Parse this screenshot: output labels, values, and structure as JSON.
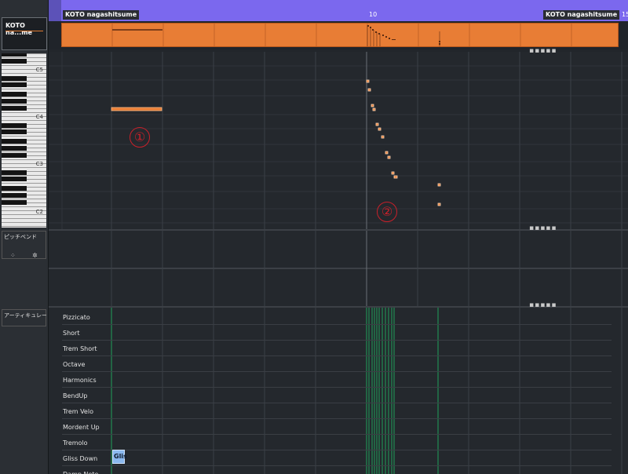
{
  "part": {
    "name_left": "KOTO nagashitsume",
    "name_right": "KOTO nagashitsume",
    "ruler_bar_10": "10",
    "ruler_bar_15": "15",
    "color": "#e87d35"
  },
  "track": {
    "label": "KOTO na...me"
  },
  "keyboard": {
    "labels": [
      "C5",
      "C4",
      "C3",
      "C2"
    ]
  },
  "controller_lanes": {
    "pitchbend_label": "ピッチベンド",
    "articulation_label": "アーティキュレーション"
  },
  "articulations": [
    "Pizzicato",
    "Short",
    "Trem Short",
    "Octave",
    "Harmonics",
    "BendUp",
    "Trem Velo",
    "Mordent Up",
    "Tremolo",
    "Gliss Down",
    "Damp Note"
  ],
  "gliss_block_label": "Glis",
  "annotations": {
    "one": "①",
    "two": "②"
  },
  "icons": {
    "pb_btn_left": "lane-shrink-icon",
    "pb_btn_right": "lane-settings-icon"
  }
}
